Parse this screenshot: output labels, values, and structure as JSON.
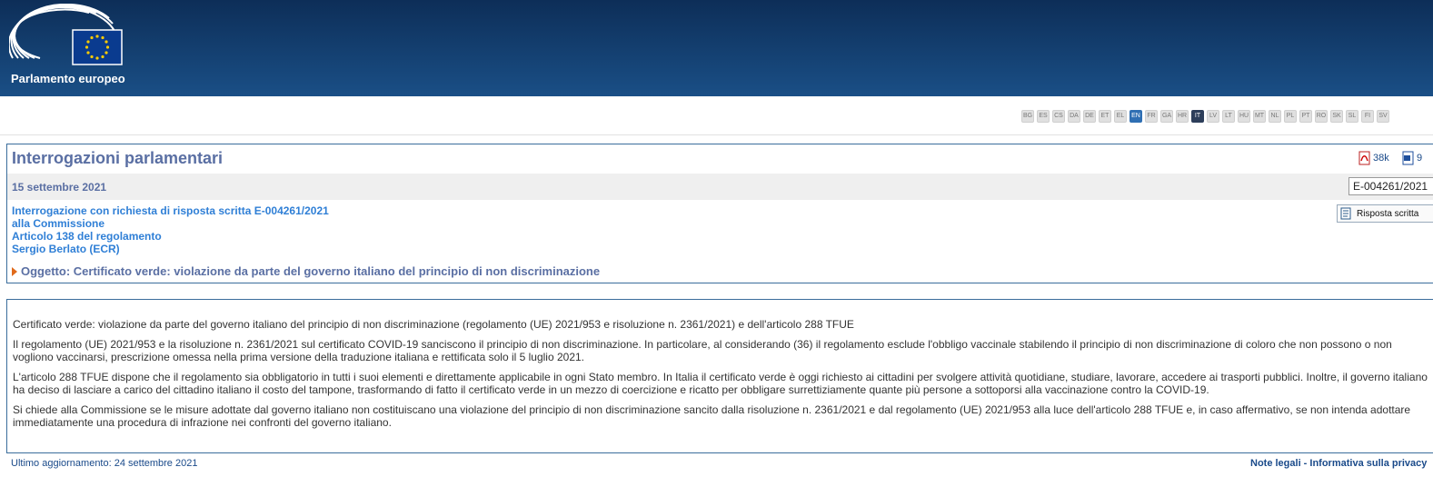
{
  "header": {
    "logo_text": "Parlamento europeo"
  },
  "languages": [
    "BG",
    "ES",
    "CS",
    "DA",
    "DE",
    "ET",
    "EL",
    "EN",
    "FR",
    "GA",
    "HR",
    "IT",
    "LV",
    "LT",
    "HU",
    "MT",
    "NL",
    "PL",
    "PT",
    "RO",
    "SK",
    "SL",
    "FI",
    "SV"
  ],
  "active_languages": [
    "EN",
    "IT"
  ],
  "question": {
    "section_title": "Interrogazioni parlamentari",
    "pdf_size": "38k",
    "doc_size": "9",
    "date": "15 settembre 2021",
    "reference": "E-004261/2021",
    "type_line": "Interrogazione con richiesta di risposta scritta  E-004261/2021",
    "addressee": "alla Commissione",
    "rule": "Articolo 138 del regolamento",
    "author": "Sergio Berlato (ECR)",
    "answer_button": "Risposta scritta",
    "subject": "Oggetto: Certificato verde: violazione da parte del governo italiano del principio di non discriminazione"
  },
  "body": {
    "paragraphs": [
      "Certificato verde: violazione da parte del governo italiano del principio di non discriminazione (regolamento (UE) 2021/953 e risoluzione n. 2361/2021) e dell'articolo 288 TFUE",
      "Il regolamento (UE) 2021/953 e la risoluzione n. 2361/2021 sul certificato COVID-19 sanciscono il principio di non discriminazione. In particolare, al considerando (36) il regolamento esclude l'obbligo vaccinale stabilendo il principio di non discriminazione di coloro che non possono o non vogliono vaccinarsi, prescrizione omessa nella prima versione della traduzione italiana e rettificata solo il 5 luglio 2021.",
      "L'articolo 288 TFUE dispone che il regolamento sia obbligatorio in tutti i suoi elementi e direttamente applicabile in ogni Stato membro. In Italia il certificato verde è oggi richiesto ai cittadini per svolgere attività quotidiane, studiare, lavorare, accedere ai trasporti pubblici. Inoltre, il governo italiano ha deciso di lasciare a carico del cittadino italiano il costo del tampone, trasformando di fatto il certificato verde in un mezzo di coercizione e ricatto per obbligare surrettiziamente quante più persone a sottoporsi alla vaccinazione contro la COVID-19.",
      "Si chiede alla Commissione se le misure adottate dal governo italiano non costituiscano una violazione del principio di non discriminazione sancito dalla risoluzione n. 2361/2021 e dal regolamento (UE) 2021/953 alla luce dell'articolo 288 TFUE e, in caso affermativo, se non intenda adottare immediatamente una procedura di infrazione nei confronti del governo italiano."
    ]
  },
  "footer": {
    "last_update": "Ultimo aggiornamento: 24 settembre 2021",
    "links": "Note legali - Informativa sulla privacy"
  }
}
